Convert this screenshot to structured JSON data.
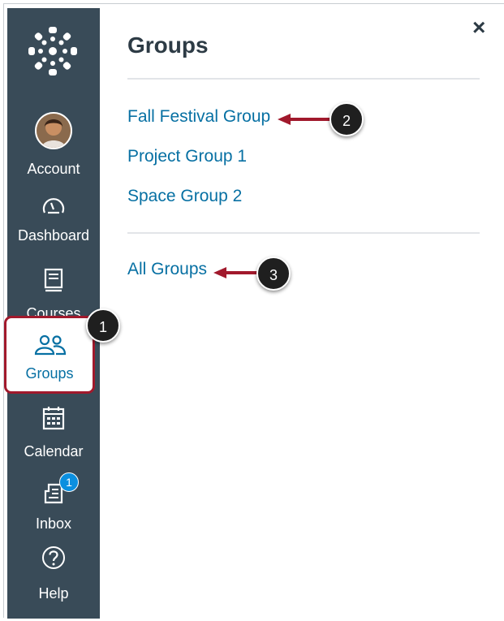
{
  "nav": {
    "items": [
      {
        "label": "Account",
        "icon": "user-avatar"
      },
      {
        "label": "Dashboard",
        "icon": "speedometer-icon"
      },
      {
        "label": "Courses",
        "icon": "book-icon"
      },
      {
        "label": "Groups",
        "icon": "users-icon",
        "active": true
      },
      {
        "label": "Calendar",
        "icon": "calendar-icon"
      },
      {
        "label": "Inbox",
        "icon": "inbox-icon",
        "badge": "1"
      },
      {
        "label": "Help",
        "icon": "help-circle-icon"
      }
    ]
  },
  "tray": {
    "title": "Groups",
    "close": "×",
    "groups": [
      {
        "label": "Fall Festival Group"
      },
      {
        "label": "Project Group 1"
      },
      {
        "label": "Space Group 2"
      }
    ],
    "all_groups": "All Groups"
  },
  "callouts": [
    "1",
    "2",
    "3"
  ],
  "colors": {
    "nav_bg": "#394b58",
    "link": "#0770a3",
    "highlight": "#a1192c",
    "arrow": "#a1192c",
    "badge": "#0b8fdf"
  }
}
